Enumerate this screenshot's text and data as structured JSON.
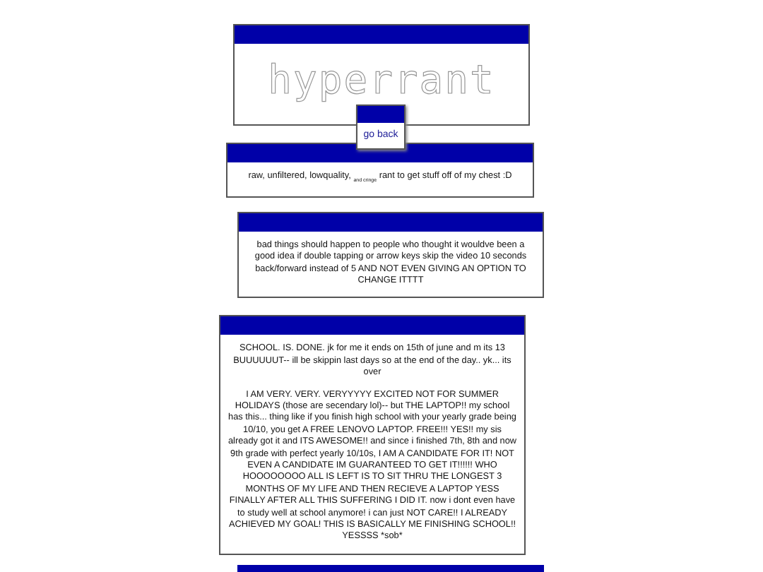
{
  "header": {
    "title": "hyperrant"
  },
  "back_link": {
    "label": "go back"
  },
  "posts": [
    {
      "markup": true,
      "paragraphs": [
        "raw, unfiltered, lowquality, $_{and cringe}$ rant to get stuff off of my chest :D"
      ]
    },
    {
      "paragraphs": [
        "bad things should happen to people who thought it wouldve been a good idea if double tapping or arrow keys skip the video 10 seconds back/forward instead of 5 AND NOT EVEN GIVING AN OPTION TO CHANGE ITTTT"
      ]
    },
    {
      "paragraphs": [
        "SCHOOL. IS. DONE. jk for me it ends on 15th of june and m its 13 BUUUUUUT-- ill be skippin last days so at the end of the day.. yk... its over",
        "I AM VERY. VERY. VERYYYYY EXCITED NOT FOR SUMMER HOLIDAYS (those are secendary lol)-- but THE LAPTOP!! my school has this... thing like if you finish high school with your yearly grade being 10/10, you get A FREE LENOVO LAPTOP. FREE!!! YES!! my sis already got it and ITS AWESOME!! and since i finished 7th, 8th and now 9th grade with perfect yearly 10/10s, I AM A CANDIDATE FOR IT! NOT EVEN A CANDIDATE IM GUARANTEED TO GET IT!!!!!! WHO HOOOOOOOO ALL IS LEFT IS TO SIT THRU THE LONGEST 3 MONTHS OF MY LIFE AND THEN RECIEVE A LAPTOP YESS FINALLY AFTER ALL THIS SUFFERING I DID IT. now i dont even have to study well at school anymore! i can just NOT CARE!! I ALREADY ACHIEVED MY GOAL! THIS IS BASICALLY ME FINISHING SCHOOL!! YESSSS *sob*"
      ]
    }
  ]
}
